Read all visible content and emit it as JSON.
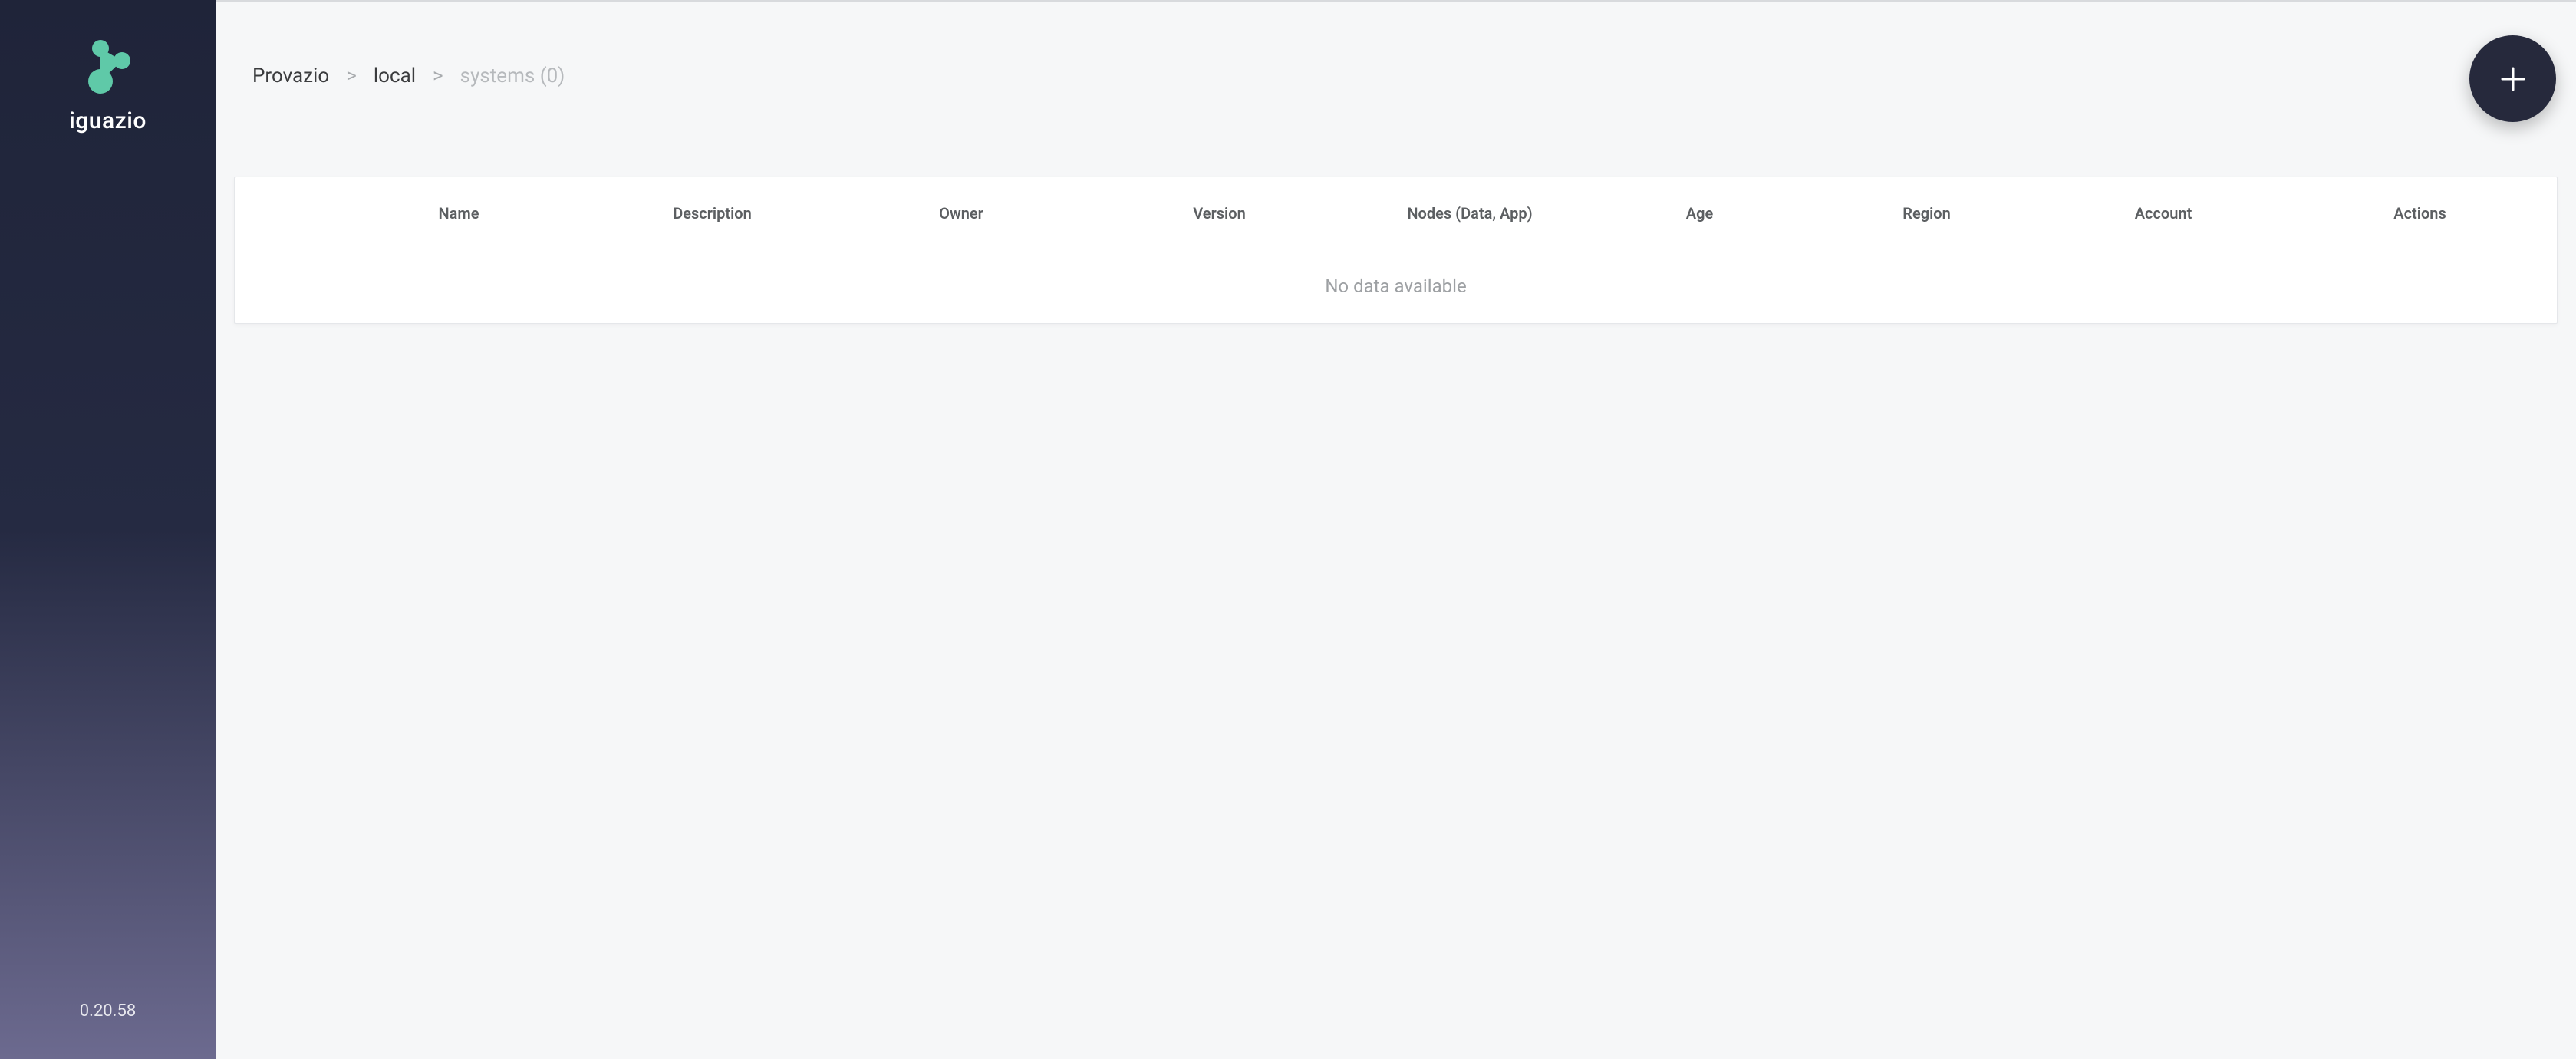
{
  "brand": {
    "name": "iguazio",
    "accent": "#5fc9a8"
  },
  "version": "0.20.58",
  "breadcrumb": {
    "root": "Provazio",
    "second": "local",
    "current": "systems (0)",
    "sep": ">"
  },
  "table": {
    "columns": {
      "name": "Name",
      "description": "Description",
      "owner": "Owner",
      "version": "Version",
      "nodes": "Nodes (Data, App)",
      "age": "Age",
      "region": "Region",
      "account": "Account",
      "actions": "Actions"
    },
    "empty_message": "No data available",
    "rows": []
  }
}
